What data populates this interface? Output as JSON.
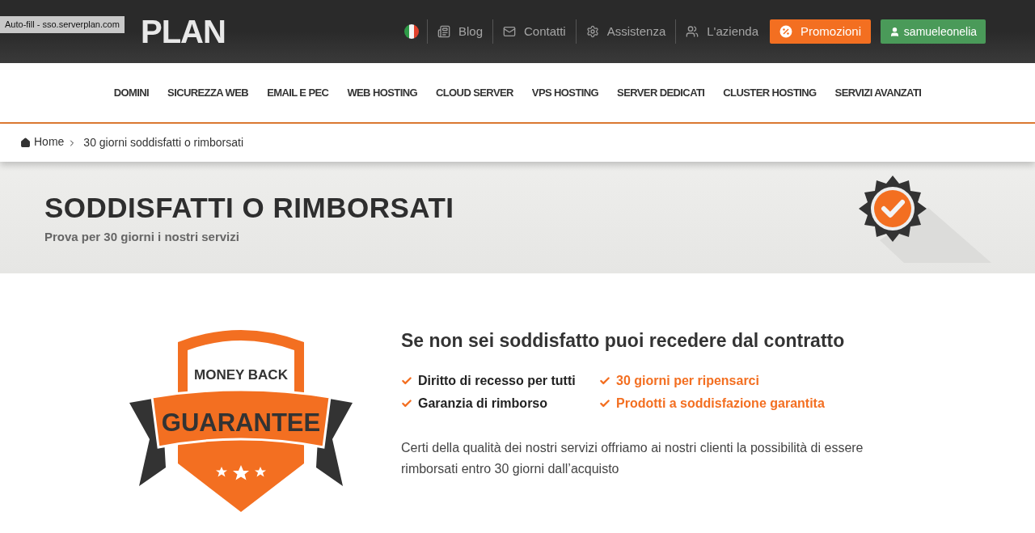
{
  "header": {
    "logo": "PLAN",
    "autofill_tooltip": "Auto-fill - sso.serverplan.com",
    "links": [
      {
        "kind": "flag"
      },
      {
        "kind": "blog",
        "label": "Blog"
      },
      {
        "kind": "mail",
        "label": "Contatti"
      },
      {
        "kind": "gear",
        "label": "Assistenza"
      },
      {
        "kind": "users",
        "label": "L'azienda"
      }
    ],
    "promo_button": "Promozioni",
    "user_button": "samueleonelia"
  },
  "nav": [
    "DOMINI",
    "SICUREZZA WEB",
    "EMAIL E PEC",
    "WEB HOSTING",
    "CLOUD SERVER",
    "VPS HOSTING",
    "SERVER DEDICATI",
    "CLUSTER HOSTING",
    "SERVIZI AVANZATI"
  ],
  "breadcrumb": [
    "Home",
    "30 giorni soddisfatti o rimborsati"
  ],
  "hero": {
    "title": "SODDISFATTI O RIMBORSATI",
    "subtitle": "Prova per 30 giorni i nostri servizi"
  },
  "badge": {
    "top": "MONEY BACK",
    "ribbon": "GUARANTEE"
  },
  "content": {
    "heading": "Se non sei soddisfatto puoi recedere dal contratto",
    "features": [
      {
        "label": "Diritto di recesso per tutti",
        "highlight": false
      },
      {
        "label": "30 giorni per ripensarci",
        "highlight": true
      },
      {
        "label": "Garanzia di rimborso",
        "highlight": false
      },
      {
        "label": "Prodotti a soddisfazione garantita",
        "highlight": true
      }
    ],
    "text": "Certi della qualità dei nostri servizi offriamo ai nostri clienti la possibilità di essere rimborsati entro 30 giorni dall’acquisto"
  }
}
